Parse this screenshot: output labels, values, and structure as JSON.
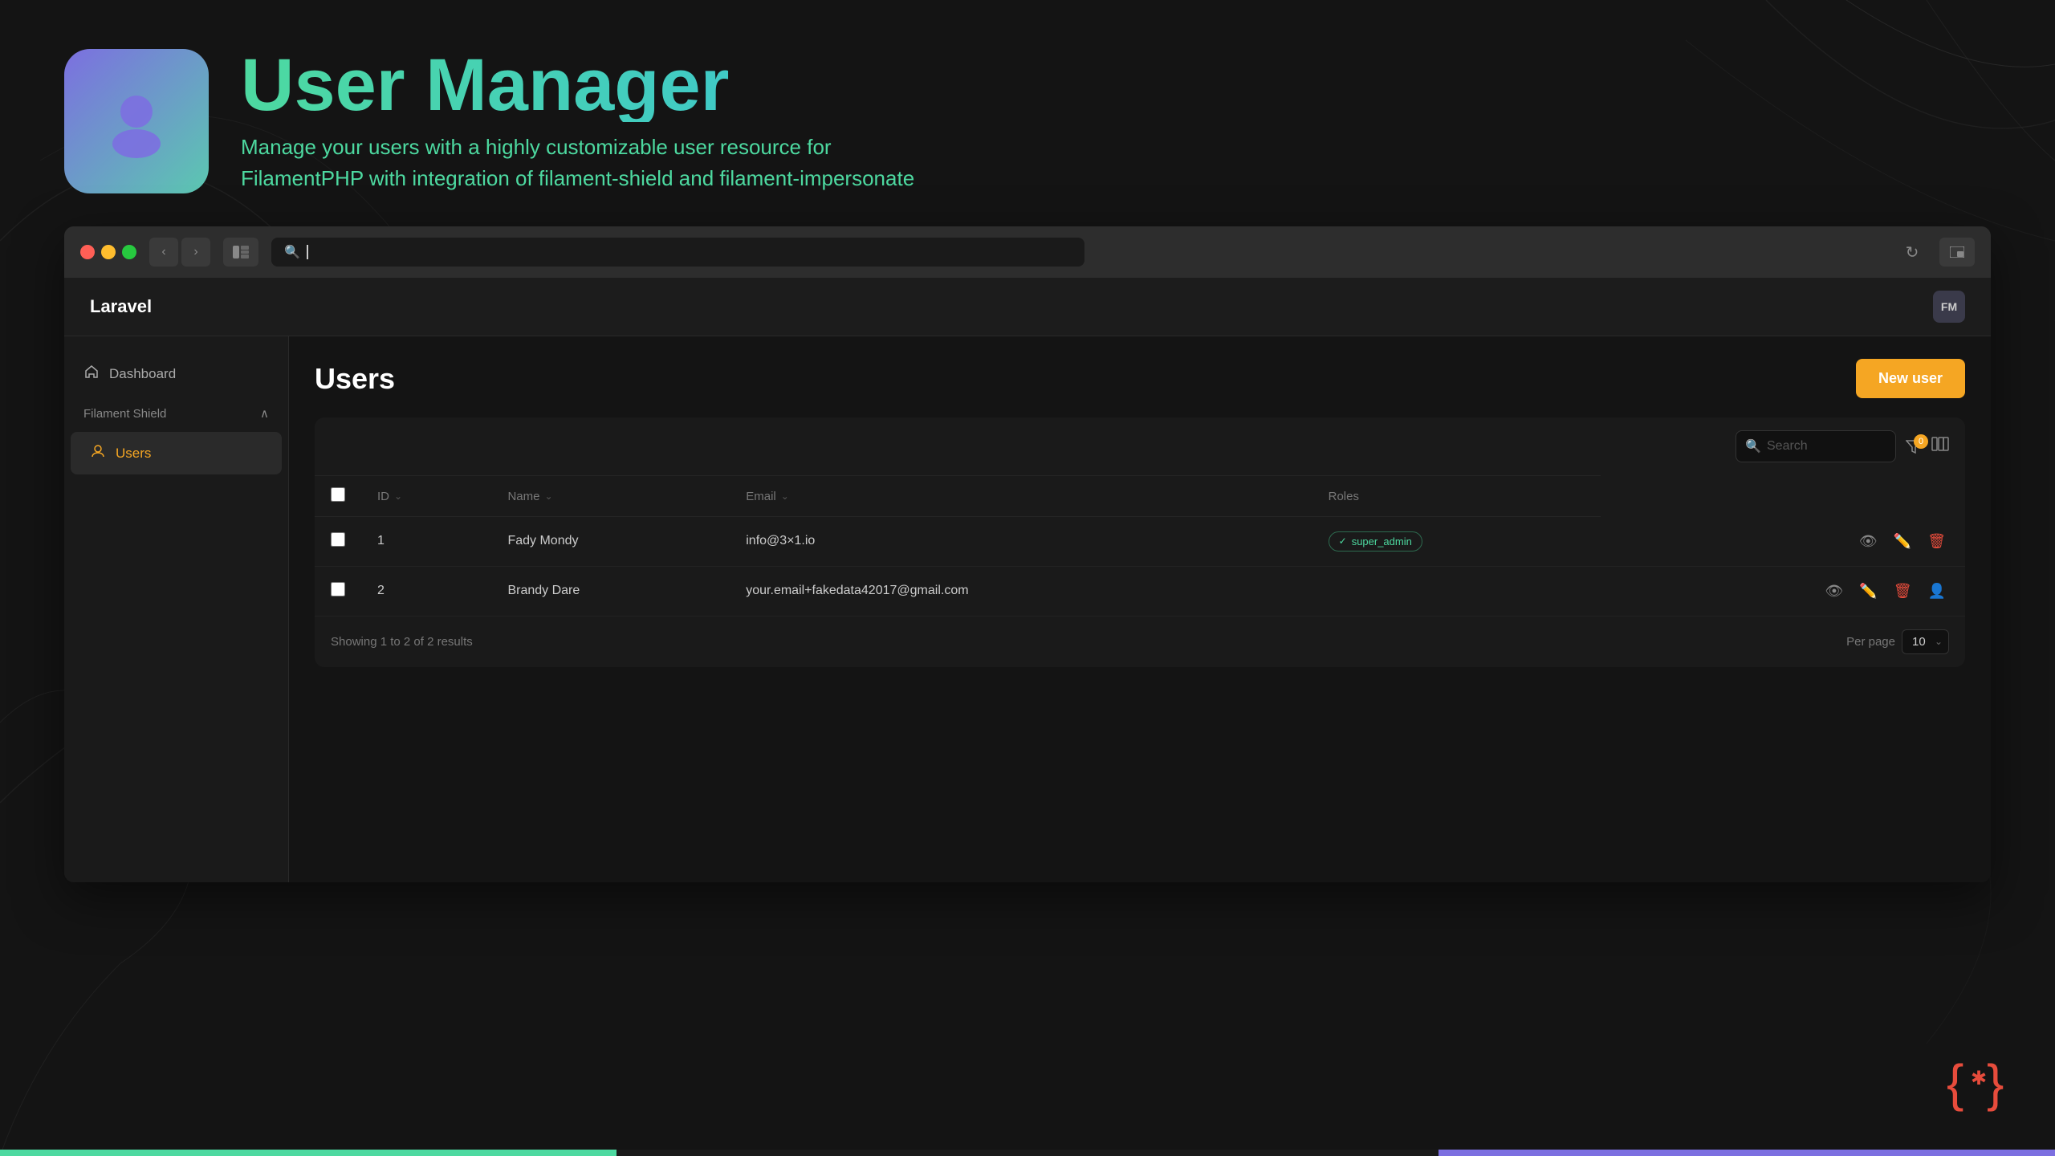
{
  "background": {
    "color": "#141414"
  },
  "header": {
    "logo_alt": "User Manager Logo",
    "title": "User Manager",
    "subtitle_line1": "Manage your users with a highly customizable user resource for",
    "subtitle_line2": "FilamentPHP with integration of filament-shield and filament-impersonate"
  },
  "browser": {
    "address_bar_placeholder": "|",
    "app_name": "Laravel",
    "user_initials": "FM"
  },
  "sidebar": {
    "nav_items": [
      {
        "label": "Dashboard",
        "icon": "home"
      }
    ],
    "section": {
      "label": "Filament Shield",
      "expanded": true
    },
    "active_item": {
      "label": "Users",
      "icon": "user"
    }
  },
  "page": {
    "title": "Users",
    "new_user_button": "New user"
  },
  "table": {
    "search_placeholder": "Search",
    "filter_count": "0",
    "columns": [
      {
        "key": "id",
        "label": "ID",
        "sortable": true
      },
      {
        "key": "name",
        "label": "Name",
        "sortable": true
      },
      {
        "key": "email",
        "label": "Email",
        "sortable": true
      },
      {
        "key": "roles",
        "label": "Roles",
        "sortable": false
      }
    ],
    "rows": [
      {
        "id": "1",
        "name": "Fady Mondy",
        "email": "info@3×1.io",
        "role": "super_admin",
        "has_role": true
      },
      {
        "id": "2",
        "name": "Brandy Dare",
        "email": "your.email+fakedata42017@gmail.com",
        "role": null,
        "has_role": false
      }
    ],
    "footer": {
      "showing_text": "Showing 1 to 2 of 2 results",
      "per_page_label": "Per page",
      "per_page_value": "10"
    }
  },
  "actions": {
    "view_icon": "👁",
    "edit_icon": "✏",
    "delete_icon": "🗑",
    "impersonate_icon": "👤"
  }
}
